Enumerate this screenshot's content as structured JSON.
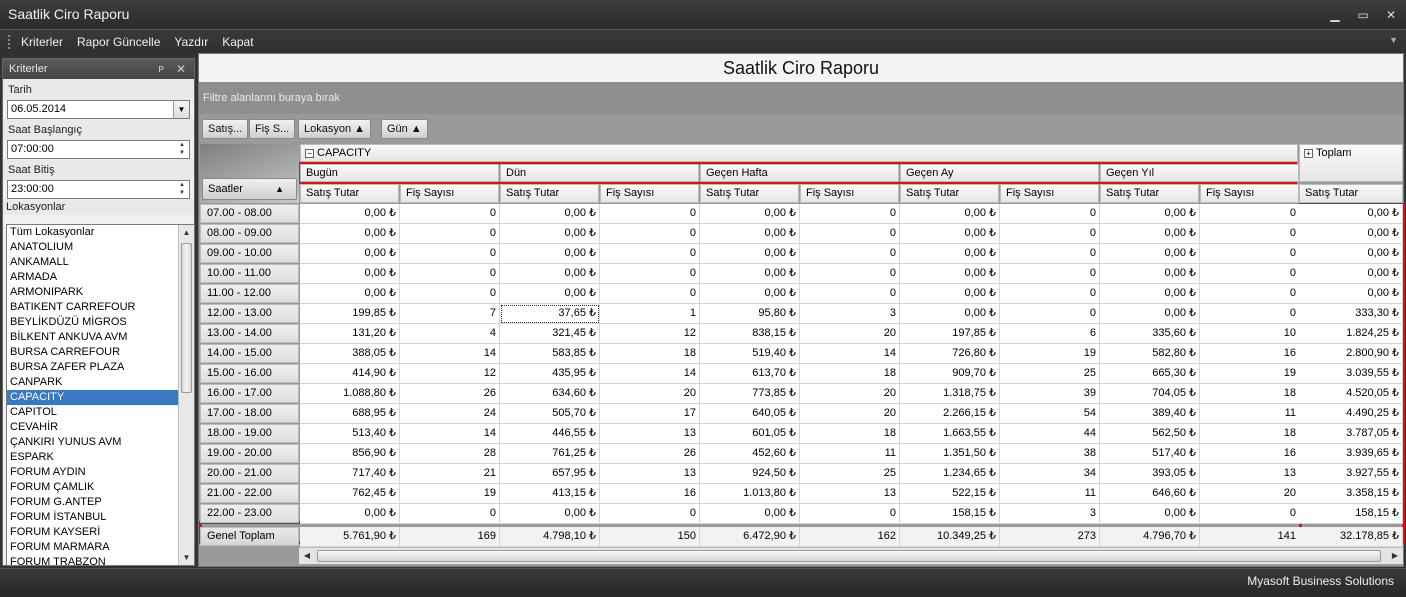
{
  "window": {
    "title": "Saatlik Ciro Raporu"
  },
  "menu": {
    "items": [
      "Kriterler",
      "Rapor Güncelle",
      "Yazdır",
      "Kapat"
    ]
  },
  "left_panel": {
    "title": "Kriterler",
    "date_label": "Tarih",
    "date_value": "06.05.2014",
    "start_label": "Saat Başlangıç",
    "start_value": "07:00:00",
    "end_label": "Saat Bitiş",
    "end_value": "23:00:00",
    "locations_label": "Lokasyonlar",
    "locations": [
      "Tüm Lokasyonlar",
      "ANATOLIUM",
      "ANKAMALL",
      "ARMADA",
      "ARMONIPARK",
      "BATIKENT CARREFOUR",
      "BEYLİKDÜZÜ MİGROS",
      "BİLKENT ANKUVA AVM",
      "BURSA CARREFOUR",
      "BURSA ZAFER PLAZA",
      "CANPARK",
      "CAPACITY",
      "CAPITOL",
      "CEVAHİR",
      "ÇANKIRI YUNUS AVM",
      "ESPARK",
      "FORUM AYDIN",
      "FORUM ÇAMLIK",
      "FORUM G.ANTEP",
      "FORUM İSTANBUL",
      "FORUM KAYSERİ",
      "FORUM MARMARA",
      "FORUM TRABZON"
    ],
    "selected_location": "CAPACITY"
  },
  "report": {
    "title": "Saatlik Ciro Raporu",
    "filter_hint": "Filtre alanlarını buraya bırak",
    "field_buttons": [
      "Satış...",
      "Fiş S...",
      "Lokasyon ▲",
      "Gün ▲"
    ],
    "row_field": "Saatler",
    "column_root": "CAPACITY",
    "total_header": "Toplam",
    "groups": [
      "Bugün",
      "Dün",
      "Geçen Hafta",
      "Geçen Ay",
      "Geçen Yıl"
    ],
    "measure_labels": [
      "Satış Tutar",
      "Fiş Sayısı"
    ],
    "total_measure": "Satış Tutar",
    "rows": [
      {
        "label": "07.00 - 08.00",
        "values": [
          "0,00 ₺",
          "0",
          "0,00 ₺",
          "0",
          "0,00 ₺",
          "0",
          "0,00 ₺",
          "0",
          "0,00 ₺",
          "0"
        ],
        "total": "0,00 ₺"
      },
      {
        "label": "08.00 - 09.00",
        "values": [
          "0,00 ₺",
          "0",
          "0,00 ₺",
          "0",
          "0,00 ₺",
          "0",
          "0,00 ₺",
          "0",
          "0,00 ₺",
          "0"
        ],
        "total": "0,00 ₺"
      },
      {
        "label": "09.00 - 10.00",
        "values": [
          "0,00 ₺",
          "0",
          "0,00 ₺",
          "0",
          "0,00 ₺",
          "0",
          "0,00 ₺",
          "0",
          "0,00 ₺",
          "0"
        ],
        "total": "0,00 ₺"
      },
      {
        "label": "10.00 - 11.00",
        "values": [
          "0,00 ₺",
          "0",
          "0,00 ₺",
          "0",
          "0,00 ₺",
          "0",
          "0,00 ₺",
          "0",
          "0,00 ₺",
          "0"
        ],
        "total": "0,00 ₺"
      },
      {
        "label": "11.00 - 12.00",
        "values": [
          "0,00 ₺",
          "0",
          "0,00 ₺",
          "0",
          "0,00 ₺",
          "0",
          "0,00 ₺",
          "0",
          "0,00 ₺",
          "0"
        ],
        "total": "0,00 ₺"
      },
      {
        "label": "12.00 - 13.00",
        "values": [
          "199,85 ₺",
          "7",
          "37,65 ₺",
          "1",
          "95,80 ₺",
          "3",
          "0,00 ₺",
          "0",
          "0,00 ₺",
          "0"
        ],
        "total": "333,30 ₺"
      },
      {
        "label": "13.00 - 14.00",
        "values": [
          "131,20 ₺",
          "4",
          "321,45 ₺",
          "12",
          "838,15 ₺",
          "20",
          "197,85 ₺",
          "6",
          "335,60 ₺",
          "10"
        ],
        "total": "1.824,25 ₺"
      },
      {
        "label": "14.00 - 15.00",
        "values": [
          "388,05 ₺",
          "14",
          "583,85 ₺",
          "18",
          "519,40 ₺",
          "14",
          "726,80 ₺",
          "19",
          "582,80 ₺",
          "16"
        ],
        "total": "2.800,90 ₺"
      },
      {
        "label": "15.00 - 16.00",
        "values": [
          "414,90 ₺",
          "12",
          "435,95 ₺",
          "14",
          "613,70 ₺",
          "18",
          "909,70 ₺",
          "25",
          "665,30 ₺",
          "19"
        ],
        "total": "3.039,55 ₺"
      },
      {
        "label": "16.00 - 17.00",
        "values": [
          "1.088,80 ₺",
          "26",
          "634,60 ₺",
          "20",
          "773,85 ₺",
          "20",
          "1.318,75 ₺",
          "39",
          "704,05 ₺",
          "18"
        ],
        "total": "4.520,05 ₺"
      },
      {
        "label": "17.00 - 18.00",
        "values": [
          "688,95 ₺",
          "24",
          "505,70 ₺",
          "17",
          "640,05 ₺",
          "20",
          "2.266,15 ₺",
          "54",
          "389,40 ₺",
          "11"
        ],
        "total": "4.490,25 ₺"
      },
      {
        "label": "18.00 - 19.00",
        "values": [
          "513,40 ₺",
          "14",
          "446,55 ₺",
          "13",
          "601,05 ₺",
          "18",
          "1.663,55 ₺",
          "44",
          "562,50 ₺",
          "18"
        ],
        "total": "3.787,05 ₺"
      },
      {
        "label": "19.00 - 20.00",
        "values": [
          "856,90 ₺",
          "28",
          "761,25 ₺",
          "26",
          "452,60 ₺",
          "11",
          "1.351,50 ₺",
          "38",
          "517,40 ₺",
          "16"
        ],
        "total": "3.939,65 ₺"
      },
      {
        "label": "20.00 - 21.00",
        "values": [
          "717,40 ₺",
          "21",
          "657,95 ₺",
          "13",
          "924,50 ₺",
          "25",
          "1.234,65 ₺",
          "34",
          "393,05 ₺",
          "13"
        ],
        "total": "3.927,55 ₺"
      },
      {
        "label": "21.00 - 22.00",
        "values": [
          "762,45 ₺",
          "19",
          "413,15 ₺",
          "16",
          "1.013,80 ₺",
          "13",
          "522,15 ₺",
          "11",
          "646,60 ₺",
          "20"
        ],
        "total": "3.358,15 ₺"
      },
      {
        "label": "22.00 - 23.00",
        "values": [
          "0,00 ₺",
          "0",
          "0,00 ₺",
          "0",
          "0,00 ₺",
          "0",
          "158,15 ₺",
          "3",
          "0,00 ₺",
          "0"
        ],
        "total": "158,15 ₺"
      }
    ],
    "grand_total": {
      "label": "Genel Toplam",
      "values": [
        "5.761,90 ₺",
        "169",
        "4.798,10 ₺",
        "150",
        "6.472,90 ₺",
        "162",
        "10.349,25 ₺",
        "273",
        "4.796,70 ₺",
        "141"
      ],
      "total": "32.178,85 ₺"
    }
  },
  "status": {
    "text": "Myasoft Business Solutions"
  },
  "colors": {
    "highlight": "#e01010",
    "selection": "#3a78c3"
  }
}
